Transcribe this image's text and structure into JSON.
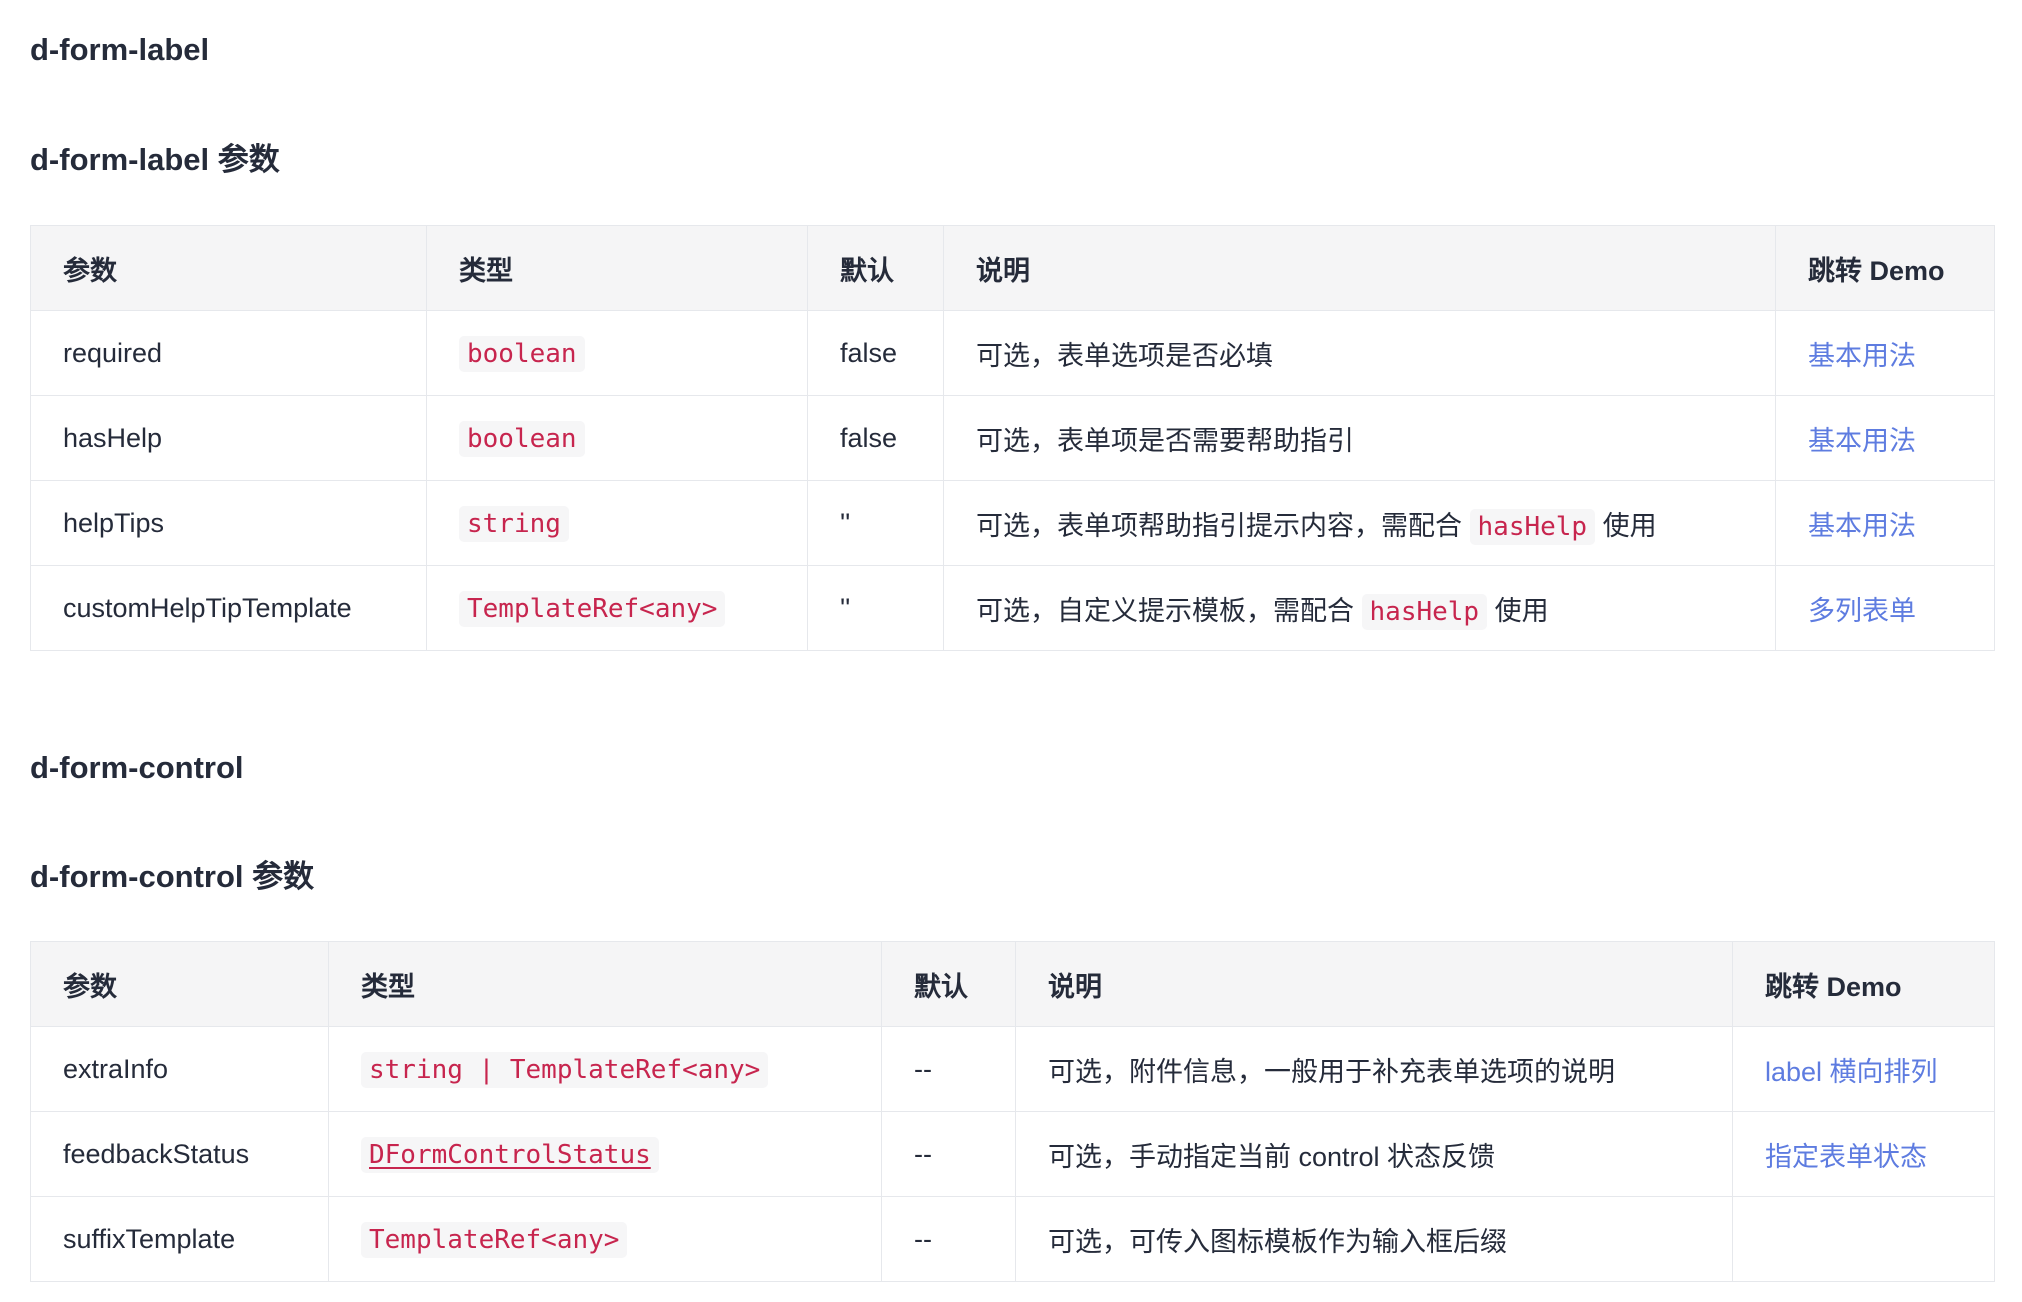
{
  "label_section": {
    "heading": "d-form-label",
    "subheading": "d-form-label 参数",
    "columns": [
      "参数",
      "类型",
      "默认",
      "说明",
      "跳转 Demo"
    ],
    "rows": [
      {
        "param": "required",
        "type": "boolean",
        "default": "false",
        "desc_before": "可选，表单选项是否必填",
        "desc_code": "",
        "desc_after": "",
        "demo": "基本用法"
      },
      {
        "param": "hasHelp",
        "type": "boolean",
        "default": "false",
        "desc_before": "可选，表单项是否需要帮助指引",
        "desc_code": "",
        "desc_after": "",
        "demo": "基本用法"
      },
      {
        "param": "helpTips",
        "type": "string",
        "default": "''",
        "desc_before": "可选，表单项帮助指引提示内容，需配合 ",
        "desc_code": "hasHelp",
        "desc_after": " 使用",
        "demo": "基本用法"
      },
      {
        "param": "customHelpTipTemplate",
        "type": "TemplateRef<any>",
        "default": "''",
        "desc_before": "可选，自定义提示模板，需配合 ",
        "desc_code": "hasHelp",
        "desc_after": " 使用",
        "demo": "多列表单"
      }
    ]
  },
  "control_section": {
    "heading": "d-form-control",
    "subheading": "d-form-control 参数",
    "columns": [
      "参数",
      "类型",
      "默认",
      "说明",
      "跳转 Demo"
    ],
    "rows": [
      {
        "param": "extraInfo",
        "type": "string | TemplateRef<any>",
        "default": "--",
        "desc": "可选，附件信息，一般用于补充表单选项的说明",
        "demo": "label 横向排列"
      },
      {
        "param": "feedbackStatus",
        "type": "DFormControlStatus",
        "default": "--",
        "desc": "可选，手动指定当前 control 状态反馈",
        "demo": "指定表单状态"
      },
      {
        "param": "suffixTemplate",
        "type": "TemplateRef<any>",
        "default": "--",
        "desc": "可选，可传入图标模板作为输入框后缀",
        "demo": ""
      }
    ]
  }
}
